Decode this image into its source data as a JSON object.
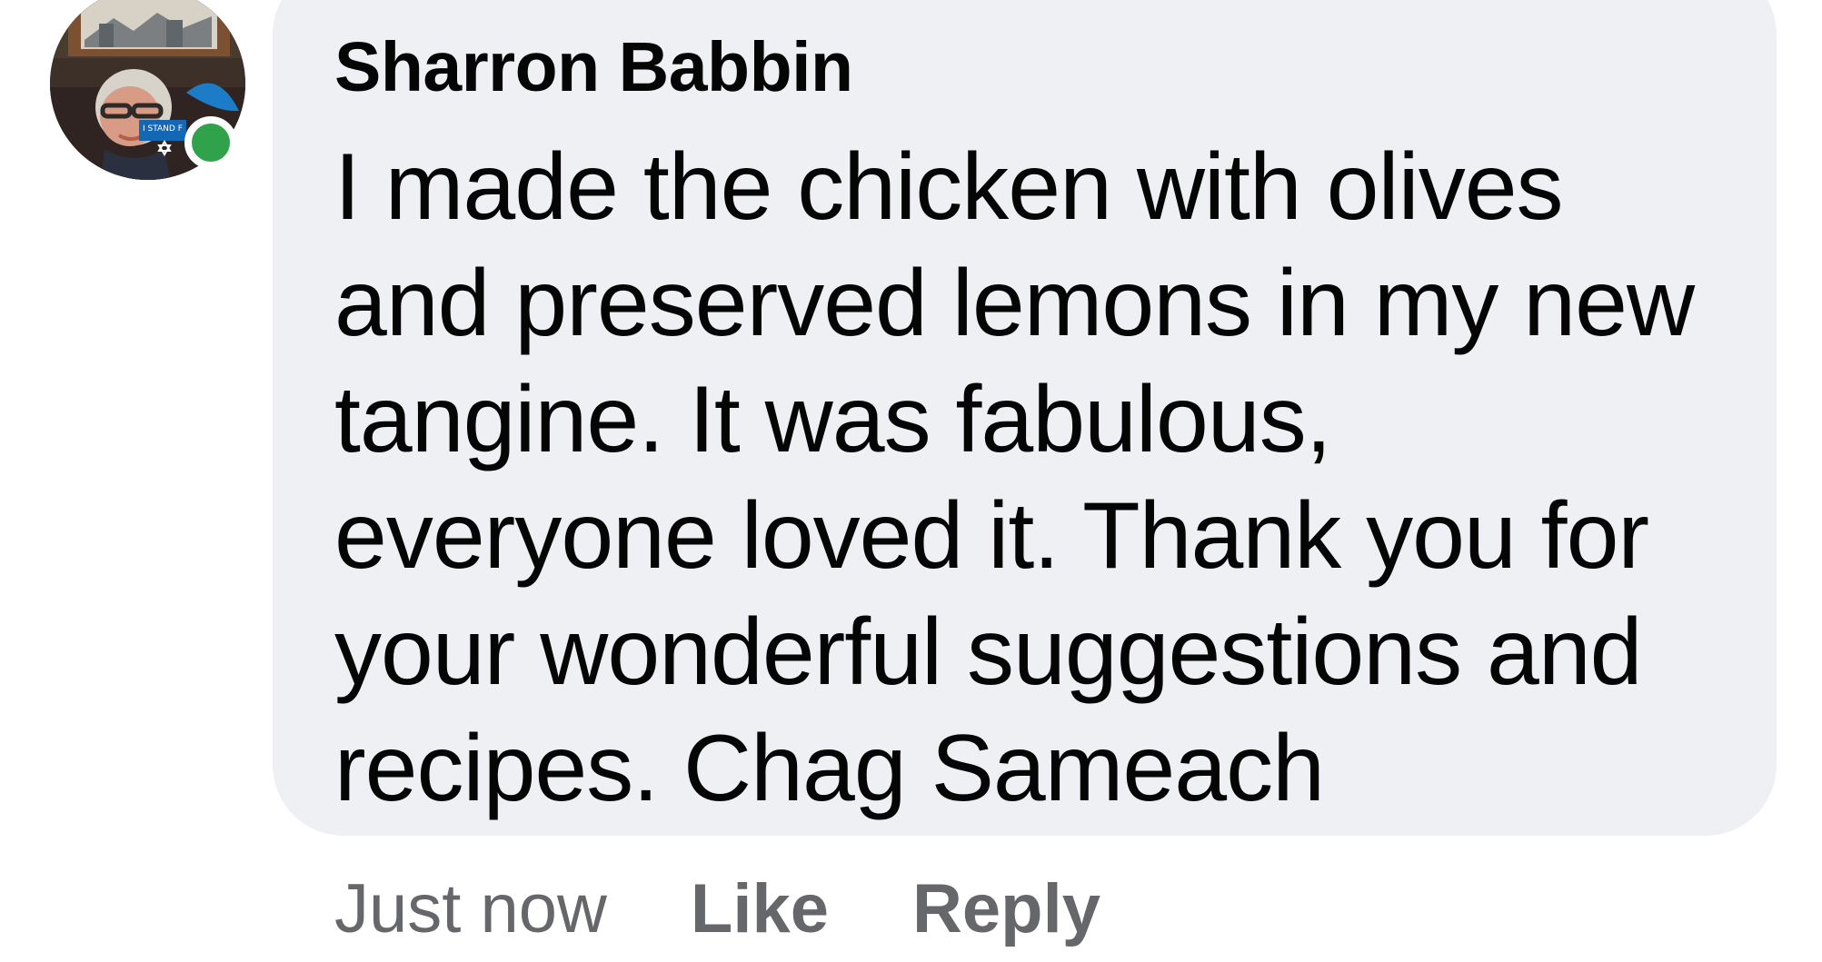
{
  "comment": {
    "author": "Sharron Babbin",
    "text": "I made the chicken with olives\nand preserved lemons in my new\ntangine.  It was fabulous,\neveryone loved it.  Thank you for\nyour wonderful suggestions and\nrecipes. Chag Sameach",
    "avatar_badge_text": "I STAND F",
    "timestamp": "Just now",
    "actions": {
      "like_label": "Like",
      "reply_label": "Reply"
    },
    "online": true
  },
  "colors": {
    "bubble": "#eef0f3",
    "text": "#050505",
    "meta_text": "#65676b",
    "presence": "#31a24c"
  },
  "icons": {
    "presence": "online-status-dot"
  }
}
